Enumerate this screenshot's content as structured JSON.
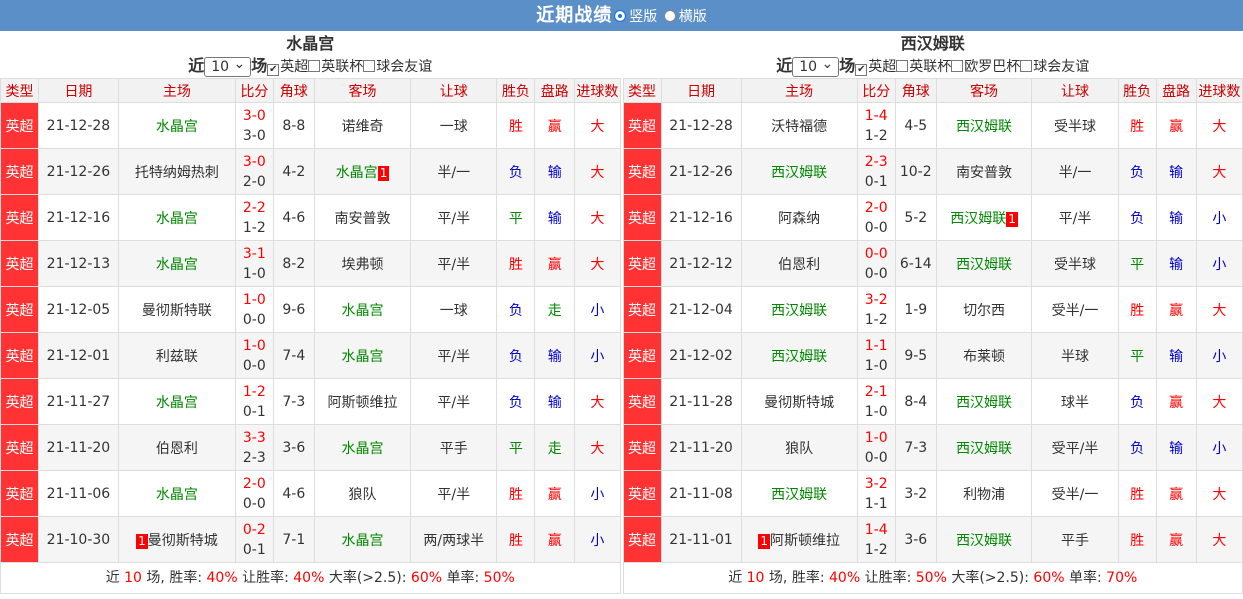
{
  "header": {
    "title": "近期战绩",
    "opt1": "竖版",
    "opt2": "横版"
  },
  "columns": [
    "类型",
    "日期",
    "主场",
    "比分",
    "角球",
    "客场",
    "让球",
    "胜负",
    "盘路",
    "进球数"
  ],
  "left": {
    "team": "水晶宫",
    "pre": "近",
    "count": "10",
    "post": "场",
    "filters": [
      {
        "label": "英超",
        "checked": true
      },
      {
        "label": "英联杯",
        "checked": false
      },
      {
        "label": "球会友谊",
        "checked": false
      }
    ],
    "rows": [
      {
        "type": "英超",
        "date": "21-12-28",
        "home": "水晶宫",
        "hg": true,
        "hc": "",
        "ft": "3-0",
        "ht": "3-0",
        "corner": "8-8",
        "away": "诺维奇",
        "ag": false,
        "ac": "",
        "hcp": "一球",
        "res": "胜",
        "rc": "red",
        "pan": "赢",
        "pc": "red",
        "goal": "大",
        "gc": "red"
      },
      {
        "type": "英超",
        "date": "21-12-26",
        "home": "托特纳姆热刺",
        "hg": false,
        "hc": "",
        "ft": "3-0",
        "ht": "2-0",
        "corner": "4-2",
        "away": "水晶宫",
        "ag": true,
        "ac": "1",
        "hcp": "半/一",
        "res": "负",
        "rc": "blue",
        "pan": "输",
        "pc": "blue",
        "goal": "大",
        "gc": "red"
      },
      {
        "type": "英超",
        "date": "21-12-16",
        "home": "水晶宫",
        "hg": true,
        "hc": "",
        "ft": "2-2",
        "ht": "1-2",
        "corner": "4-6",
        "away": "南安普敦",
        "ag": false,
        "ac": "",
        "hcp": "平/半",
        "res": "平",
        "rc": "green",
        "pan": "输",
        "pc": "blue",
        "goal": "大",
        "gc": "red"
      },
      {
        "type": "英超",
        "date": "21-12-13",
        "home": "水晶宫",
        "hg": true,
        "hc": "",
        "ft": "3-1",
        "ht": "1-0",
        "corner": "8-2",
        "away": "埃弗顿",
        "ag": false,
        "ac": "",
        "hcp": "平/半",
        "res": "胜",
        "rc": "red",
        "pan": "赢",
        "pc": "red",
        "goal": "大",
        "gc": "red"
      },
      {
        "type": "英超",
        "date": "21-12-05",
        "home": "曼彻斯特联",
        "hg": false,
        "hc": "",
        "ft": "1-0",
        "ht": "0-0",
        "corner": "9-6",
        "away": "水晶宫",
        "ag": true,
        "ac": "",
        "hcp": "一球",
        "res": "负",
        "rc": "blue",
        "pan": "走",
        "pc": "green",
        "goal": "小",
        "gc": "blue"
      },
      {
        "type": "英超",
        "date": "21-12-01",
        "home": "利兹联",
        "hg": false,
        "hc": "",
        "ft": "1-0",
        "ht": "0-0",
        "corner": "7-4",
        "away": "水晶宫",
        "ag": true,
        "ac": "",
        "hcp": "平/半",
        "res": "负",
        "rc": "blue",
        "pan": "输",
        "pc": "blue",
        "goal": "小",
        "gc": "blue"
      },
      {
        "type": "英超",
        "date": "21-11-27",
        "home": "水晶宫",
        "hg": true,
        "hc": "",
        "ft": "1-2",
        "ht": "0-1",
        "corner": "7-3",
        "away": "阿斯顿维拉",
        "ag": false,
        "ac": "",
        "hcp": "平/半",
        "res": "负",
        "rc": "blue",
        "pan": "输",
        "pc": "blue",
        "goal": "大",
        "gc": "red"
      },
      {
        "type": "英超",
        "date": "21-11-20",
        "home": "伯恩利",
        "hg": false,
        "hc": "",
        "ft": "3-3",
        "ht": "2-3",
        "corner": "3-6",
        "away": "水晶宫",
        "ag": true,
        "ac": "",
        "hcp": "平手",
        "res": "平",
        "rc": "green",
        "pan": "走",
        "pc": "green",
        "goal": "大",
        "gc": "red"
      },
      {
        "type": "英超",
        "date": "21-11-06",
        "home": "水晶宫",
        "hg": true,
        "hc": "",
        "ft": "2-0",
        "ht": "0-0",
        "corner": "4-6",
        "away": "狼队",
        "ag": false,
        "ac": "",
        "hcp": "平/半",
        "res": "胜",
        "rc": "red",
        "pan": "赢",
        "pc": "red",
        "goal": "小",
        "gc": "blue"
      },
      {
        "type": "英超",
        "date": "21-10-30",
        "home": "曼彻斯特城",
        "hg": false,
        "hc": "1",
        "ft": "0-2",
        "ht": "0-1",
        "corner": "7-1",
        "away": "水晶宫",
        "ag": true,
        "ac": "",
        "hcp": "两/两球半",
        "res": "胜",
        "rc": "red",
        "pan": "赢",
        "pc": "red",
        "goal": "小",
        "gc": "blue"
      }
    ],
    "foot": {
      "a": "近 ",
      "n": "10",
      "b": " 场, 胜率: ",
      "win": "40%",
      "c": " 让胜率: ",
      "hwin": "40%",
      "d": " 大率(>2.5): ",
      "big": "60%",
      "e": " 单率: ",
      "odd": "50%"
    }
  },
  "right": {
    "team": "西汉姆联",
    "pre": "近",
    "count": "10",
    "post": "场",
    "filters": [
      {
        "label": "英超",
        "checked": true
      },
      {
        "label": "英联杯",
        "checked": false
      },
      {
        "label": "欧罗巴杯",
        "checked": false
      },
      {
        "label": "球会友谊",
        "checked": false
      }
    ],
    "rows": [
      {
        "type": "英超",
        "date": "21-12-28",
        "home": "沃特福德",
        "hg": false,
        "hc": "",
        "ft": "1-4",
        "ht": "1-2",
        "corner": "4-5",
        "away": "西汉姆联",
        "ag": true,
        "ac": "",
        "hcp": "受半球",
        "res": "胜",
        "rc": "red",
        "pan": "赢",
        "pc": "red",
        "goal": "大",
        "gc": "red"
      },
      {
        "type": "英超",
        "date": "21-12-26",
        "home": "西汉姆联",
        "hg": true,
        "hc": "",
        "ft": "2-3",
        "ht": "0-1",
        "corner": "10-2",
        "away": "南安普敦",
        "ag": false,
        "ac": "",
        "hcp": "半/一",
        "res": "负",
        "rc": "blue",
        "pan": "输",
        "pc": "blue",
        "goal": "大",
        "gc": "red"
      },
      {
        "type": "英超",
        "date": "21-12-16",
        "home": "阿森纳",
        "hg": false,
        "hc": "",
        "ft": "2-0",
        "ht": "0-0",
        "corner": "5-2",
        "away": "西汉姆联",
        "ag": true,
        "ac": "1",
        "hcp": "平/半",
        "res": "负",
        "rc": "blue",
        "pan": "输",
        "pc": "blue",
        "goal": "小",
        "gc": "blue"
      },
      {
        "type": "英超",
        "date": "21-12-12",
        "home": "伯恩利",
        "hg": false,
        "hc": "",
        "ft": "0-0",
        "ht": "0-0",
        "corner": "6-14",
        "away": "西汉姆联",
        "ag": true,
        "ac": "",
        "hcp": "受半球",
        "res": "平",
        "rc": "green",
        "pan": "输",
        "pc": "blue",
        "goal": "小",
        "gc": "blue"
      },
      {
        "type": "英超",
        "date": "21-12-04",
        "home": "西汉姆联",
        "hg": true,
        "hc": "",
        "ft": "3-2",
        "ht": "1-2",
        "corner": "1-9",
        "away": "切尔西",
        "ag": false,
        "ac": "",
        "hcp": "受半/一",
        "res": "胜",
        "rc": "red",
        "pan": "赢",
        "pc": "red",
        "goal": "大",
        "gc": "red"
      },
      {
        "type": "英超",
        "date": "21-12-02",
        "home": "西汉姆联",
        "hg": true,
        "hc": "",
        "ft": "1-1",
        "ht": "1-0",
        "corner": "9-5",
        "away": "布莱顿",
        "ag": false,
        "ac": "",
        "hcp": "半球",
        "res": "平",
        "rc": "green",
        "pan": "输",
        "pc": "blue",
        "goal": "小",
        "gc": "blue"
      },
      {
        "type": "英超",
        "date": "21-11-28",
        "home": "曼彻斯特城",
        "hg": false,
        "hc": "",
        "ft": "2-1",
        "ht": "1-0",
        "corner": "8-4",
        "away": "西汉姆联",
        "ag": true,
        "ac": "",
        "hcp": "球半",
        "res": "负",
        "rc": "blue",
        "pan": "赢",
        "pc": "red",
        "goal": "大",
        "gc": "red"
      },
      {
        "type": "英超",
        "date": "21-11-20",
        "home": "狼队",
        "hg": false,
        "hc": "",
        "ft": "1-0",
        "ht": "0-0",
        "corner": "7-3",
        "away": "西汉姆联",
        "ag": true,
        "ac": "",
        "hcp": "受平/半",
        "res": "负",
        "rc": "blue",
        "pan": "输",
        "pc": "blue",
        "goal": "小",
        "gc": "blue"
      },
      {
        "type": "英超",
        "date": "21-11-08",
        "home": "西汉姆联",
        "hg": true,
        "hc": "",
        "ft": "3-2",
        "ht": "1-1",
        "corner": "3-2",
        "away": "利物浦",
        "ag": false,
        "ac": "",
        "hcp": "受半/一",
        "res": "胜",
        "rc": "red",
        "pan": "赢",
        "pc": "red",
        "goal": "大",
        "gc": "red"
      },
      {
        "type": "英超",
        "date": "21-11-01",
        "home": "阿斯顿维拉",
        "hg": false,
        "hc": "1",
        "ft": "1-4",
        "ht": "1-2",
        "corner": "3-6",
        "away": "西汉姆联",
        "ag": true,
        "ac": "",
        "hcp": "平手",
        "res": "胜",
        "rc": "red",
        "pan": "赢",
        "pc": "red",
        "goal": "大",
        "gc": "red"
      }
    ],
    "foot": {
      "a": "近 ",
      "n": "10",
      "b": " 场, 胜率: ",
      "win": "40%",
      "c": " 让胜率: ",
      "hwin": "50%",
      "d": " 大率(>2.5): ",
      "big": "60%",
      "e": " 单率: ",
      "odd": "70%"
    }
  }
}
